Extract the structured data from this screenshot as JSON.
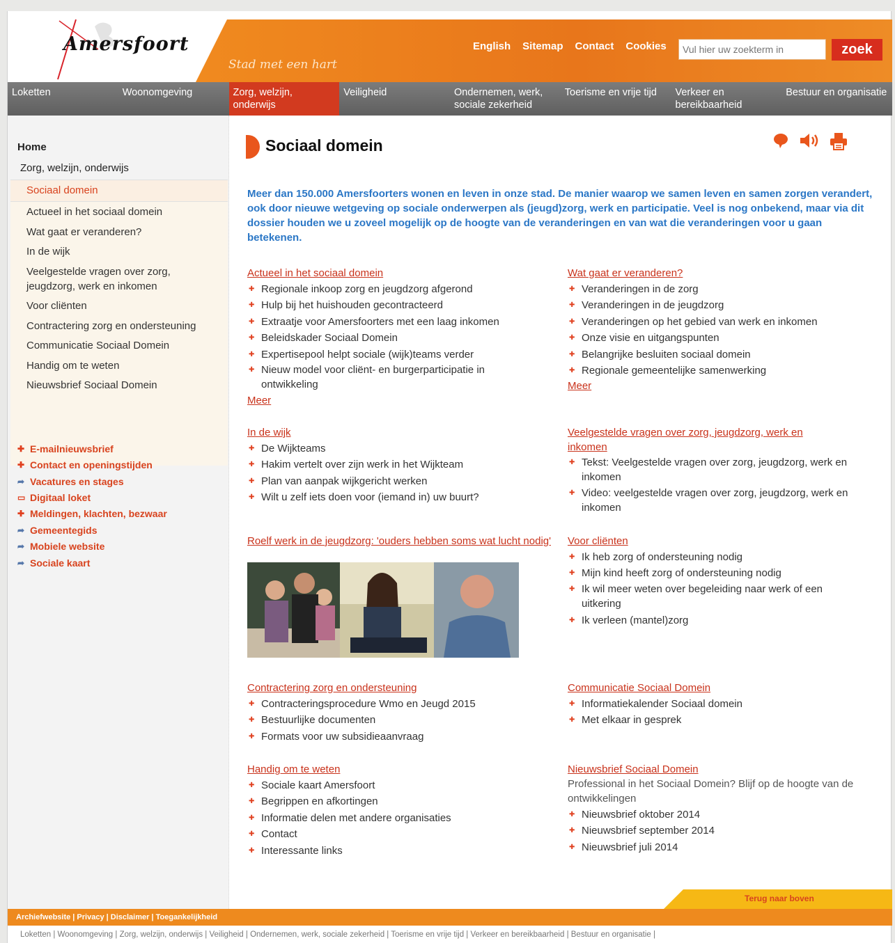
{
  "header": {
    "logo_text": "Amersfoort",
    "tagline": "Stad met een hart",
    "top_links": [
      "English",
      "Sitemap",
      "Contact",
      "Cookies"
    ],
    "search_placeholder": "Vul hier uw zoekterm in",
    "search_button": "zoek"
  },
  "nav": {
    "items": [
      "Loketten",
      "Woonomgeving",
      "Zorg, welzijn, onderwijs",
      "Veiligheid",
      "Ondernemen, werk, sociale zekerheid",
      "Toerisme en vrije tijd",
      "Verkeer en bereikbaarheid",
      "Bestuur en organisatie"
    ],
    "active": "Zorg, welzijn, onderwijs"
  },
  "sidebar": {
    "home": "Home",
    "section": "Zorg, welzijn, onderwijs",
    "active": "Sociaal domein",
    "sub_items": [
      "Actueel in het sociaal domein",
      "Wat gaat er veranderen?",
      "In de wijk",
      "Veelgestelde vragen over zorg, jeugdzorg, werk en inkomen",
      "Voor cliënten",
      "Contractering zorg en ondersteuning",
      "Communicatie Sociaal Domein",
      "Handig om te weten",
      "Nieuwsbrief Sociaal Domein"
    ],
    "utility_links": [
      {
        "label": "E-mailnieuwsbrief",
        "icon": "plus-icon"
      },
      {
        "label": "Contact en openingstijden",
        "icon": "plus-icon"
      },
      {
        "label": "Vacatures en stages",
        "icon": "external-link-icon"
      },
      {
        "label": "Digitaal loket",
        "icon": "computer-icon"
      },
      {
        "label": "Meldingen, klachten, bezwaar",
        "icon": "plus-icon"
      },
      {
        "label": "Gemeentegids",
        "icon": "external-link-icon"
      },
      {
        "label": "Mobiele website",
        "icon": "external-link-icon"
      },
      {
        "label": "Sociale kaart",
        "icon": "external-link-icon"
      }
    ]
  },
  "main": {
    "title": "Sociaal domein",
    "tools": [
      "speech-bubble-icon",
      "speaker-icon",
      "print-icon"
    ],
    "intro": "Meer dan 150.000 Amersfoorters wonen en leven in onze stad. De manier waarop we samen leven en samen zorgen verandert, ook door nieuwe wetgeving op sociale onderwerpen als (jeugd)zorg, werk en participatie. Veel is nog onbekend, maar via dit dossier houden we u zoveel mogelijk op de hoogte van de veranderingen en van wat die veranderingen voor u gaan betekenen.",
    "more_label": "Meer",
    "sections": {
      "actueel": {
        "title": "Actueel in het sociaal domein",
        "items": [
          "Regionale inkoop zorg en jeugdzorg afgerond",
          "Hulp bij het huishouden gecontracteerd",
          "Extraatje voor Amersfoorters met een laag inkomen",
          "Beleidskader Sociaal Domein",
          "Expertisepool helpt sociale (wijk)teams verder",
          "Nieuw model voor cliënt- en burgerparticipatie in ontwikkeling"
        ]
      },
      "veranderen": {
        "title": "Wat gaat er veranderen?",
        "items": [
          "Veranderingen in de zorg",
          "Veranderingen in de jeugdzorg",
          "Veranderingen op het gebied van werk en inkomen",
          "Onze visie en uitgangspunten",
          "Belangrijke besluiten sociaal domein",
          "Regionale gemeentelijke samenwerking"
        ]
      },
      "wijk": {
        "title": "In de wijk",
        "items": [
          "De Wijkteams",
          "Hakim vertelt over zijn werk in het Wijkteam",
          "Plan van aanpak wijkgericht werken",
          "Wilt u zelf iets doen voor (iemand in) uw buurt?"
        ]
      },
      "vragen": {
        "title": "Veelgestelde vragen over zorg, jeugdzorg, werk en inkomen",
        "items": [
          "Tekst: Veelgestelde vragen over zorg, jeugdzorg, werk en inkomen",
          "Video: veelgestelde vragen over zorg, jeugdzorg, werk en inkomen"
        ]
      },
      "roelf": {
        "title": "Roelf werk in de jeugdzorg: 'ouders hebben soms wat lucht nodig'"
      },
      "clienten": {
        "title": "Voor cliënten",
        "items": [
          "Ik heb zorg of ondersteuning nodig",
          "Mijn kind heeft zorg of ondersteuning nodig",
          "Ik wil meer weten over begeleiding naar werk of een uitkering",
          "Ik verleen (mantel)zorg"
        ]
      },
      "contractering": {
        "title": "Contractering zorg en ondersteuning",
        "items": [
          "Contracteringsprocedure Wmo en Jeugd 2015",
          "Bestuurlijke documenten",
          "Formats voor uw subsidieaanvraag"
        ]
      },
      "communicatie": {
        "title": "Communicatie Sociaal Domein",
        "items": [
          "Informatiekalender Sociaal domein",
          "Met elkaar in gesprek"
        ]
      },
      "handig": {
        "title": "Handig om te weten",
        "items": [
          "Sociale kaart Amersfoort",
          "Begrippen en afkortingen",
          "Informatie delen met andere organisaties",
          "Contact",
          "Interessante links"
        ]
      },
      "nieuwsbrief": {
        "title": "Nieuwsbrief Sociaal Domein",
        "description": "Professional in het Sociaal Domein? Blijf op de hoogte van de ontwikkelingen",
        "items": [
          "Nieuwsbrief oktober 2014",
          "Nieuwsbrief september 2014",
          "Nieuwsbrief juli 2014"
        ]
      }
    }
  },
  "footer": {
    "links": "Archiefwebsite | Privacy | Disclaimer | Toegankelijkheid",
    "back_to_top": "Terug naar boven",
    "nav_line": "Loketten | Woonomgeving | Zorg, welzijn, onderwijs | Veiligheid | Ondernemen, werk, sociale zekerheid | Toerisme en vrije tijd | Verkeer en bereikbaarheid | Bestuur en organisatie |"
  },
  "colors": {
    "brand_orange": "#ee8a1e",
    "active_red": "#d23a1f",
    "link_red": "#c9321b",
    "intro_blue": "#2b77c6"
  }
}
